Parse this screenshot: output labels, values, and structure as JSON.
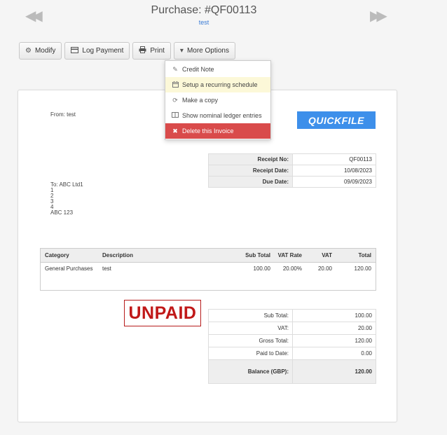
{
  "header": {
    "title": "Purchase: #QF00113",
    "subtitle": "test",
    "prev_glyph": "◀◀",
    "next_glyph": "▶▶"
  },
  "toolbar": {
    "modify_label": "Modify",
    "log_payment_label": "Log Payment",
    "print_label": "Print",
    "more_options_label": "More Options"
  },
  "more_options_menu": {
    "items": [
      {
        "label": "Credit Note",
        "icon": "eraser-icon"
      },
      {
        "label": "Setup a recurring schedule",
        "icon": "calendar-icon"
      },
      {
        "label": "Make a copy",
        "icon": "refresh-icon"
      },
      {
        "label": "Show nominal ledger entries",
        "icon": "book-icon"
      },
      {
        "label": "Delete this Invoice",
        "icon": "close-icon"
      }
    ]
  },
  "invoice": {
    "from": "From: test",
    "logo_text": "QUICKFILE",
    "receipt": {
      "receipt_no_label": "Receipt No:",
      "receipt_no": "QF00113",
      "receipt_date_label": "Receipt Date:",
      "receipt_date": "10/08/2023",
      "due_date_label": "Due Date:",
      "due_date": "09/09/2023"
    },
    "to_lines": [
      "To: ABC Ltd1",
      "1",
      "2",
      "3",
      "4",
      "ABC 123"
    ],
    "items_header": {
      "category": "Category",
      "description": "Description",
      "sub_total": "Sub Total",
      "vat_rate": "VAT Rate",
      "vat": "VAT",
      "total": "Total"
    },
    "items": [
      {
        "category": "General Purchases",
        "description": "test",
        "sub_total": "100.00",
        "vat_rate": "20.00%",
        "vat": "20.00",
        "total": "120.00"
      }
    ],
    "status_stamp": "UNPAID",
    "totals": {
      "sub_total_label": "Sub Total:",
      "sub_total": "100.00",
      "vat_label": "VAT:",
      "vat": "20.00",
      "gross_total_label": "Gross Total:",
      "gross_total": "120.00",
      "paid_label": "Paid to Date:",
      "paid": "0.00",
      "balance_label": "Balance (GBP):",
      "balance": "120.00"
    }
  },
  "colors": {
    "accent_link": "#3a7bd5",
    "logo_bg": "#3d8fea",
    "danger": "#d94b4b",
    "highlight": "#fcf8d8",
    "stamp_red": "#c01818"
  }
}
